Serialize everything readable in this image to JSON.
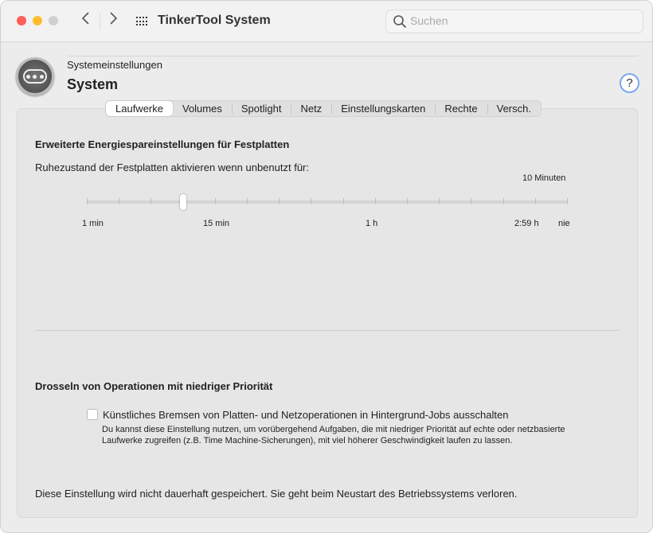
{
  "window": {
    "title": "TinkerTool System",
    "colors": {
      "close": "#fe5f57",
      "minimize": "#febc2e",
      "zoom": "#d0d0d0"
    }
  },
  "toolbar": {
    "back_icon": "chevron-left",
    "forward_icon": "chevron-right",
    "grid_icon": "grid",
    "search_placeholder": "Suchen"
  },
  "header": {
    "breadcrumb": "Systemeinstellungen",
    "title": "System",
    "help": "?"
  },
  "tabs": [
    {
      "label": "Laufwerke",
      "active": true
    },
    {
      "label": "Volumes"
    },
    {
      "label": "Spotlight"
    },
    {
      "label": "Netz"
    },
    {
      "label": "Einstellungskarten"
    },
    {
      "label": "Rechte"
    },
    {
      "label": "Versch."
    }
  ],
  "energy": {
    "heading": "Erweiterte Energiespareinstellungen für Festplatten",
    "label": "Ruhezustand der Festplatten aktivieren wenn unbenutzt für:",
    "value_text": "10 Minuten",
    "slider_fraction": 0.2,
    "tick_count": 16,
    "tick_labels": [
      "1 min",
      "15 min",
      "1 h",
      "2:59 h",
      "nie"
    ]
  },
  "throttle": {
    "heading": "Drosseln von Operationen mit niedriger Priorität",
    "checkbox_label": "Künstliches Bremsen von Platten- und Netzoperationen in Hintergrund-Jobs ausschalten",
    "checked": false,
    "description_1": "Du kannst diese Einstellung nutzen, um vorübergehend Aufgaben, die mit niedriger Priorität auf echte oder netzbasierte",
    "description_2": "Laufwerke zugreifen (z.B. Time Machine-Sicherungen), mit viel höherer Geschwindigkeit laufen zu lassen."
  },
  "footer_note": "Diese Einstellung wird nicht dauerhaft gespeichert. Sie geht beim Neustart des Betriebssystems verloren."
}
